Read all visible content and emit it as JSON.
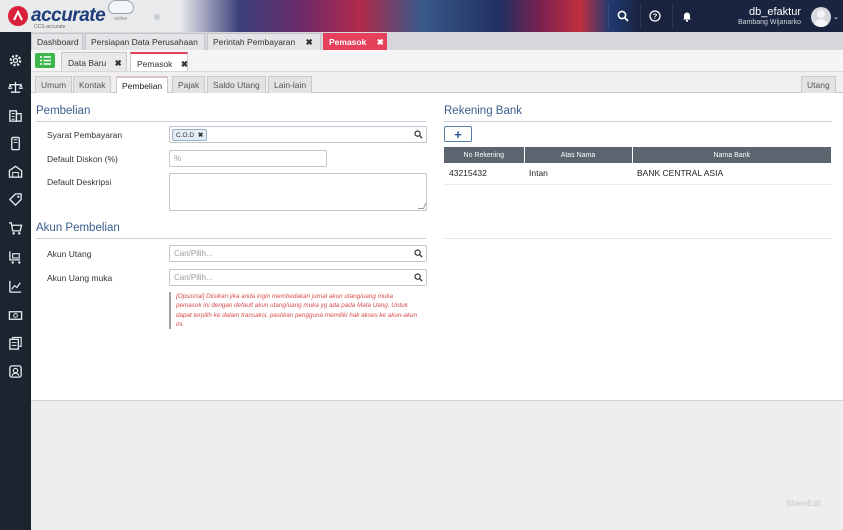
{
  "app": {
    "logo_text": "accurate",
    "logo_badge": "online",
    "logo_sub": "CCS·accurate"
  },
  "header": {
    "db_name": "db_efaktur",
    "user_name": "Bambang Wijanarko"
  },
  "module_tabs": [
    {
      "label": "Dashboard"
    },
    {
      "label": "Persiapan Data Perusahaan"
    },
    {
      "label": "Perintah Pembayaran",
      "close": "✖"
    },
    {
      "label": "Pemasok",
      "close": "✖"
    }
  ],
  "form_tabs": [
    {
      "label": "Data Baru",
      "close": "✖"
    },
    {
      "label": "Pemasok",
      "close": "✖"
    }
  ],
  "sub_tabs": [
    "Umum",
    "Kontak",
    "Pembelian",
    "Pajak",
    "Saldo Utang",
    "Lain-lain"
  ],
  "utang_tab": "Utang",
  "pembelian": {
    "title": "Pembelian",
    "syarat_label": "Syarat Pembayaran",
    "syarat_chip": "C.O.D",
    "syarat_chip_close": "✖",
    "diskon_label": "Default Diskon (%)",
    "diskon_suffix": "%",
    "deskripsi_label": "Default Deskripsi"
  },
  "akun": {
    "title": "Akun Pembelian",
    "utang_label": "Akun Utang",
    "utang_placeholder": "Cari/Pilih...",
    "uang_muka_label": "Akun Uang muka",
    "uang_muka_placeholder": "Cari/Pilih...",
    "note": "[Opsional] Diisikan jika anda ingin membedakan jurnal akun utang/uang muka pemasok ini dengan default akun utang/uang muka yg ada pada Mata Uang. Untuk dapat terpilih ke dalam transaksi, pastikan pengguna memiliki hak akses ke akun-akun ini."
  },
  "bank": {
    "title": "Rekening Bank",
    "add_label": "+",
    "columns": [
      "No Rekening",
      "Atas Nama",
      "Nama Bank"
    ],
    "rows": [
      [
        "43215432",
        "Intan",
        "BANK CENTRAL ASIA"
      ]
    ]
  },
  "watermark": "ShareEdit",
  "colors": {
    "accent": "#e7405c",
    "section_title": "#3a5f8c",
    "sidebar": "#1c2430",
    "list_button": "#3cb54a"
  }
}
